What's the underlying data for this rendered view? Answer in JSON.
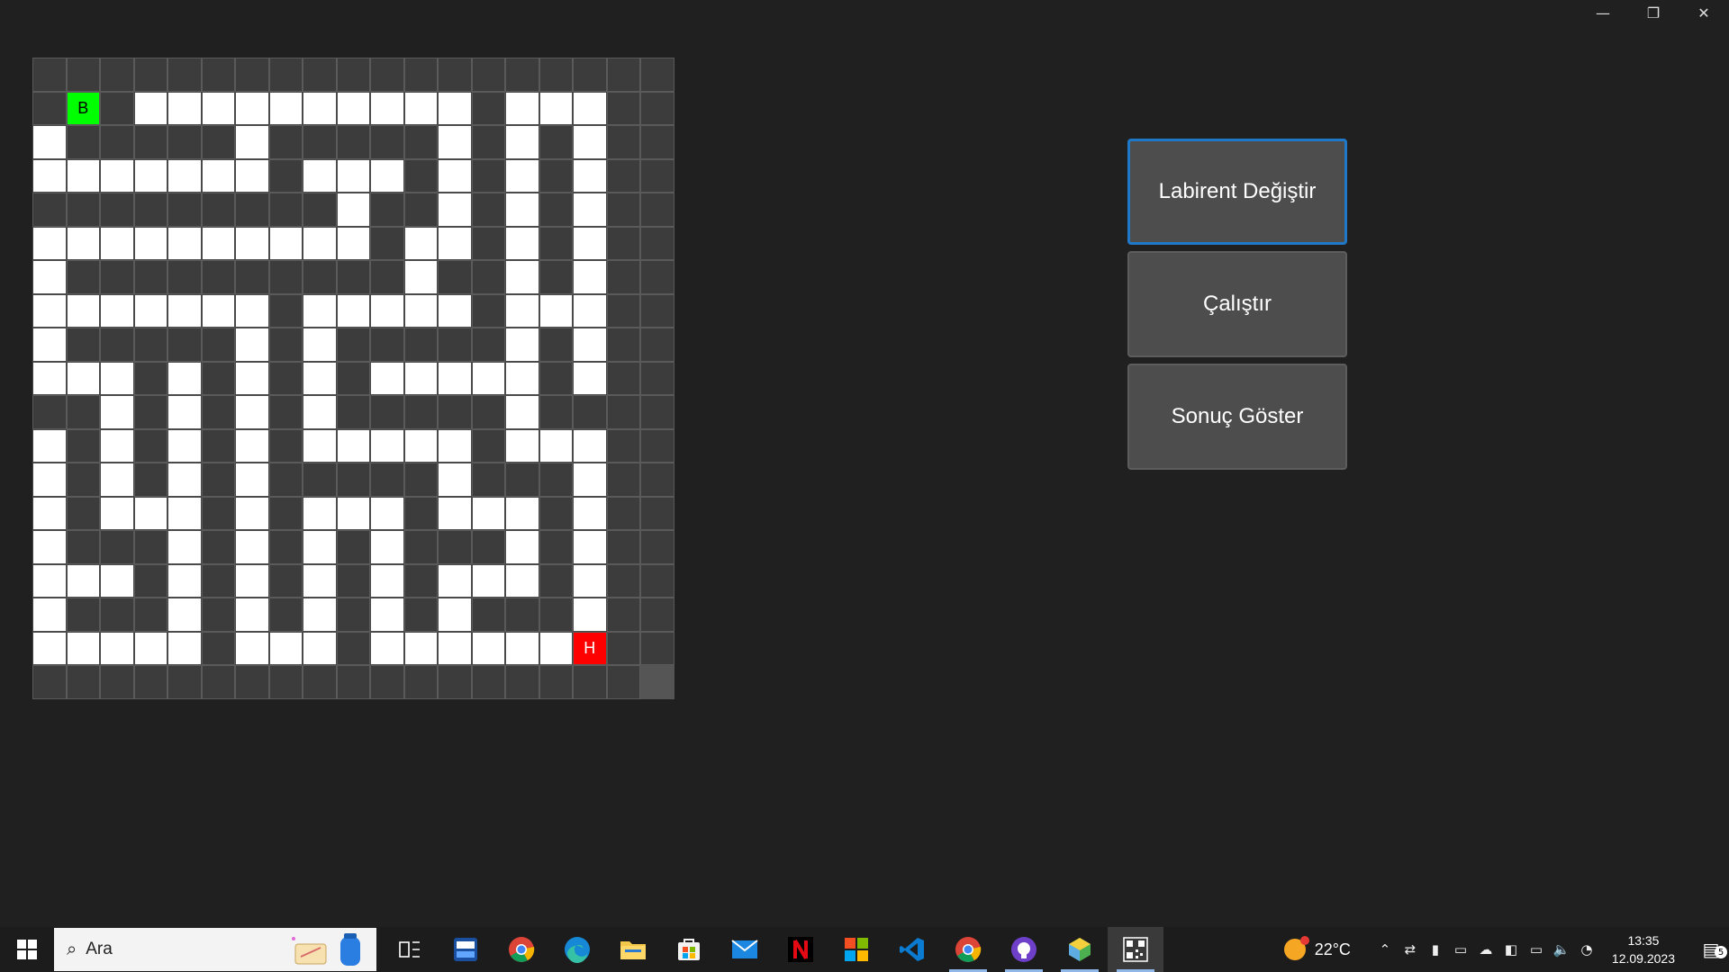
{
  "window": {
    "minimize_glyph": "—",
    "restore_glyph": "❐",
    "close_glyph": "✕"
  },
  "maze": {
    "rows": [
      "###################",
      "#S#..........#...#",
      "#.#####.#####.#.#.#",
      "#.......#...#.#.#.#",
      "##########.##.#.#.#",
      "#..........#..#.#.#",
      "#.##########.##.#.#",
      "#.......#.....#...#",
      "#.#####.#.#####.#.#",
      "#...#.#.#.#.....#.#",
      "###.#.#.#.#####.###",
      "#.#.#.#.#.....#...#",
      "#.#.#.#.#####.###.#",
      "#.#...#.#...#...#.#",
      "#.###.#.#.#.###.#.#",
      "#...#.#.#.#.#...#.#",
      "#.###.#.#.#.#.###.#",
      "#.....#...#......E#",
      "###################"
    ],
    "start_label": "B",
    "end_label": "H",
    "start_color": "#00ff00",
    "end_color": "#ff0000"
  },
  "buttons": {
    "change_maze": "Labirent Değiştir",
    "run": "Çalıştır",
    "show_result": "Sonuç Göster"
  },
  "taskbar": {
    "search_placeholder": "Ara",
    "apps": [
      {
        "name": "task-view-icon"
      },
      {
        "name": "devcx-icon"
      },
      {
        "name": "chrome-icon"
      },
      {
        "name": "edge-icon"
      },
      {
        "name": "file-explorer-icon"
      },
      {
        "name": "store-icon"
      },
      {
        "name": "mail-icon"
      },
      {
        "name": "netflix-icon"
      },
      {
        "name": "office-icon"
      },
      {
        "name": "vscode-icon"
      },
      {
        "name": "chrome-profile-icon"
      },
      {
        "name": "github-desktop-icon"
      },
      {
        "name": "box-app-icon"
      },
      {
        "name": "qr-app-icon"
      }
    ],
    "weather_temp": "22°C",
    "time": "13:35",
    "date": "12.09.2023",
    "notification_count": "5"
  },
  "colors": {
    "accent": "#1f78c8",
    "wall": "#3c3c3c",
    "path": "#ffffff",
    "background": "#202020"
  }
}
